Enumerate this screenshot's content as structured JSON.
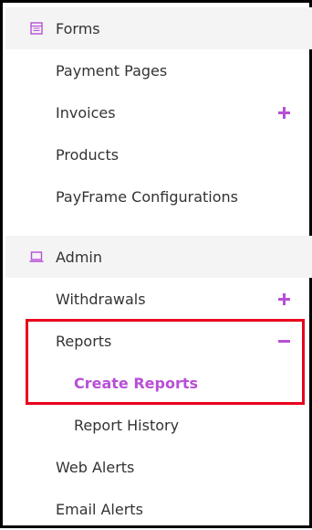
{
  "sidebar": {
    "forms_section": {
      "label": "Forms",
      "icon": "form-icon",
      "items": [
        {
          "label": "Payment Pages"
        },
        {
          "label": "Invoices",
          "toggle": "+"
        },
        {
          "label": "Products"
        },
        {
          "label": "PayFrame Configurations"
        }
      ]
    },
    "admin_section": {
      "label": "Admin",
      "icon": "laptop-icon",
      "items": [
        {
          "label": "Withdrawals",
          "toggle": "+"
        },
        {
          "label": "Reports",
          "toggle": "−",
          "expanded": true,
          "subitems": [
            {
              "label": "Create Reports",
              "active": true
            },
            {
              "label": "Report History"
            }
          ]
        },
        {
          "label": "Web Alerts"
        },
        {
          "label": "Email Alerts"
        }
      ]
    }
  },
  "colors": {
    "accent": "#b84fd6",
    "highlight_border": "#e8001c",
    "section_bg": "#f4f4f4",
    "text": "#333333"
  }
}
